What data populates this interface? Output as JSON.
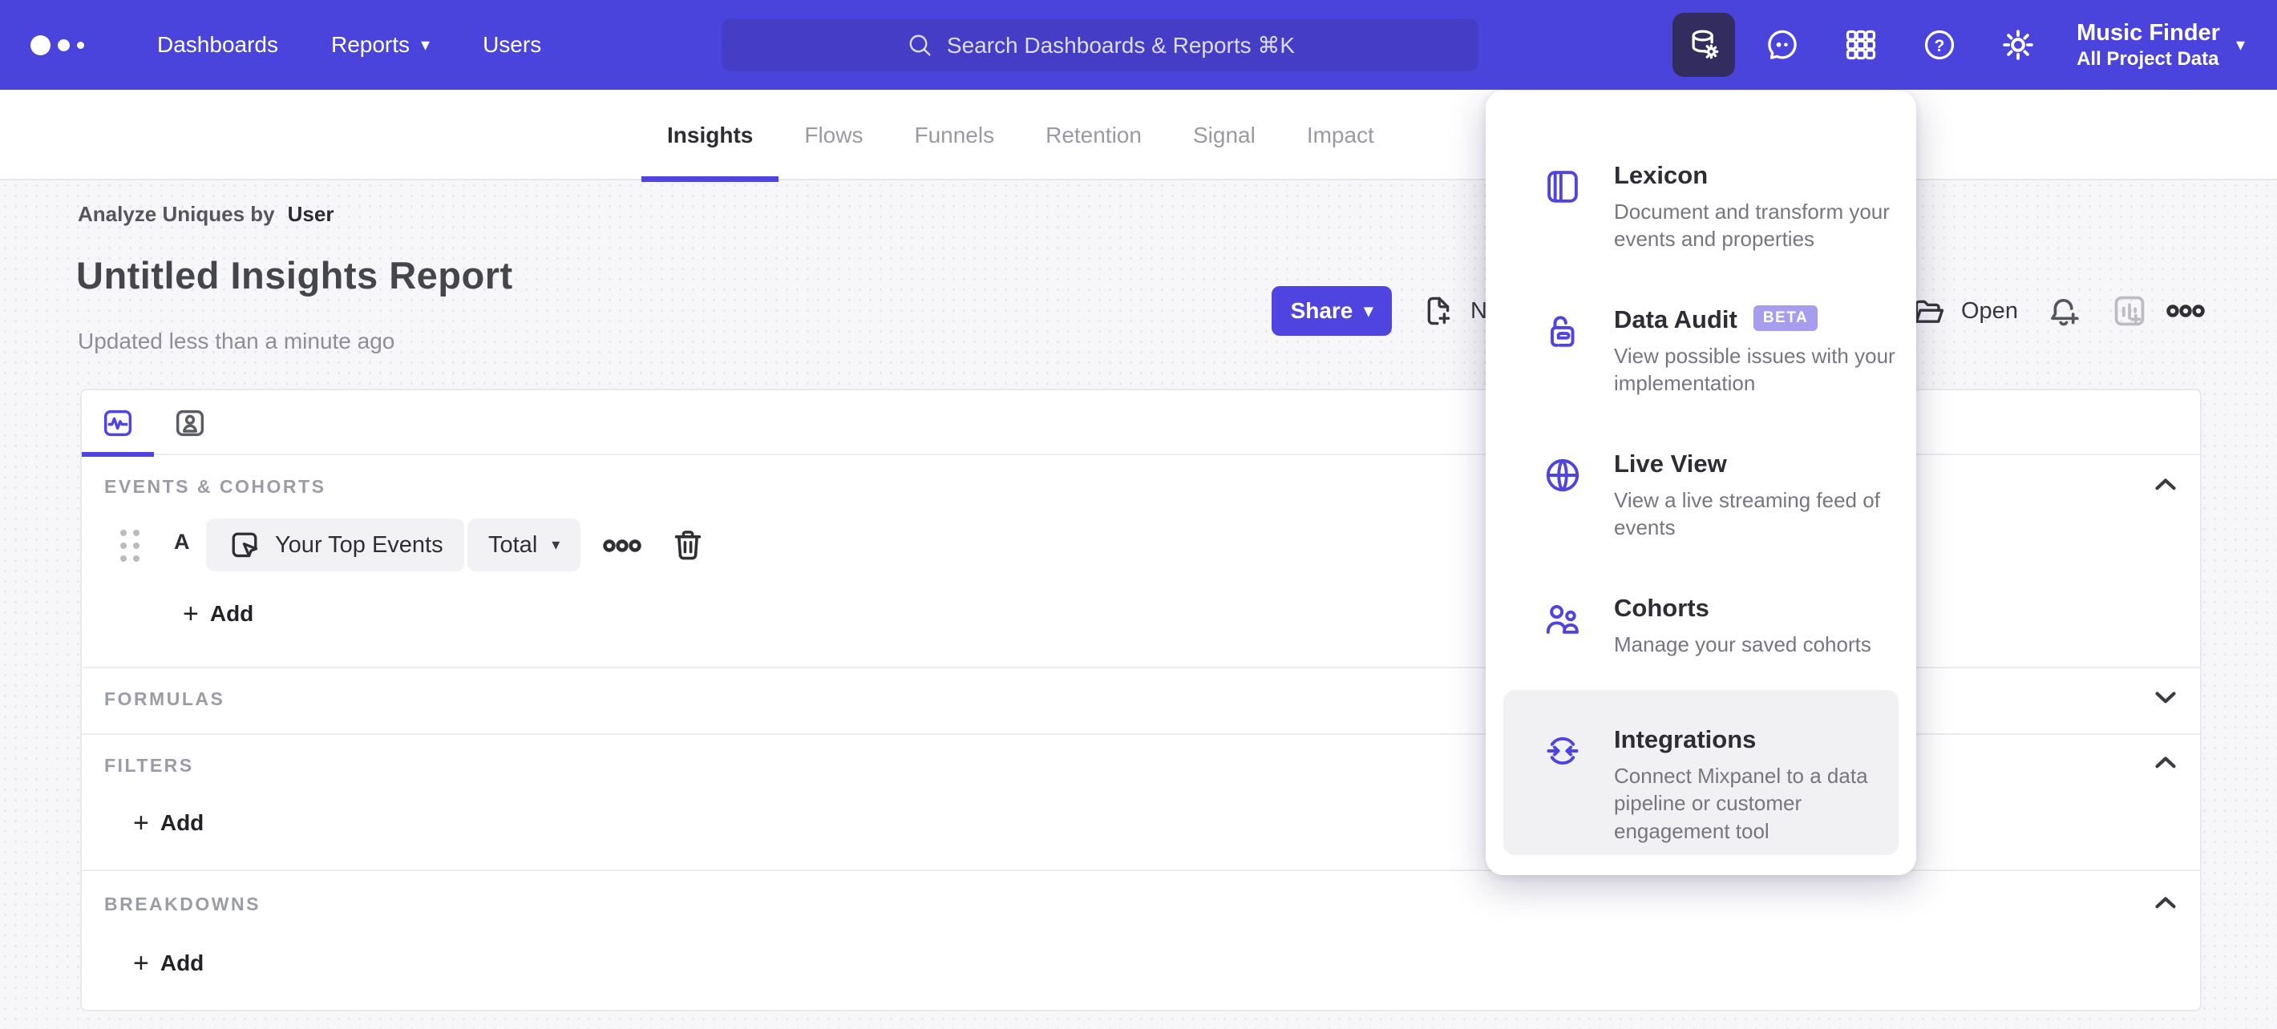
{
  "nav": {
    "items": [
      {
        "label": "Dashboards"
      },
      {
        "label": "Reports"
      },
      {
        "label": "Users"
      }
    ],
    "search": {
      "placeholder": "Search Dashboards & Reports ⌘K"
    },
    "project": {
      "name": "Music Finder",
      "scope": "All Project Data"
    },
    "help_glyph": "?"
  },
  "tabs": {
    "items": [
      {
        "label": "Insights"
      },
      {
        "label": "Flows"
      },
      {
        "label": "Funnels"
      },
      {
        "label": "Retention"
      },
      {
        "label": "Signal"
      },
      {
        "label": "Impact"
      }
    ]
  },
  "report": {
    "breadcrumb_prefix": "Analyze Uniques by",
    "breadcrumb_value": "User",
    "title": "Untitled Insights Report",
    "updated": "Updated less than a minute ago"
  },
  "toolbar": {
    "share_label": "Share",
    "new_label": "New",
    "open_label": "Open"
  },
  "builder": {
    "events": {
      "label": "EVENTS & COHORTS",
      "row": {
        "letter": "A",
        "event": "Your Top Events",
        "metric": "Total"
      },
      "add_label": "Add"
    },
    "formulas": {
      "label": "FORMULAS"
    },
    "filters": {
      "label": "FILTERS",
      "add_label": "Add"
    },
    "breakdowns": {
      "label": "BREAKDOWNS",
      "add_label": "Add"
    }
  },
  "menu": {
    "items": [
      {
        "title": "Lexicon",
        "desc": "Document and transform your events and properties"
      },
      {
        "title": "Data Audit",
        "badge": "BETA",
        "desc": "View possible issues with your implementation"
      },
      {
        "title": "Live View",
        "desc": "View a live streaming feed of events"
      },
      {
        "title": "Cohorts",
        "desc": "Manage your saved cohorts"
      },
      {
        "title": "Integrations",
        "desc": "Connect Mixpanel to a data pipeline or customer engagement tool"
      }
    ]
  },
  "glyphs": {
    "caret_down": "▾",
    "plus": "+"
  },
  "colors": {
    "accent": "#4f44e0",
    "nav_background": "#4b44dc",
    "badge_background": "#a79dee",
    "active_tile": "#332c5f"
  }
}
